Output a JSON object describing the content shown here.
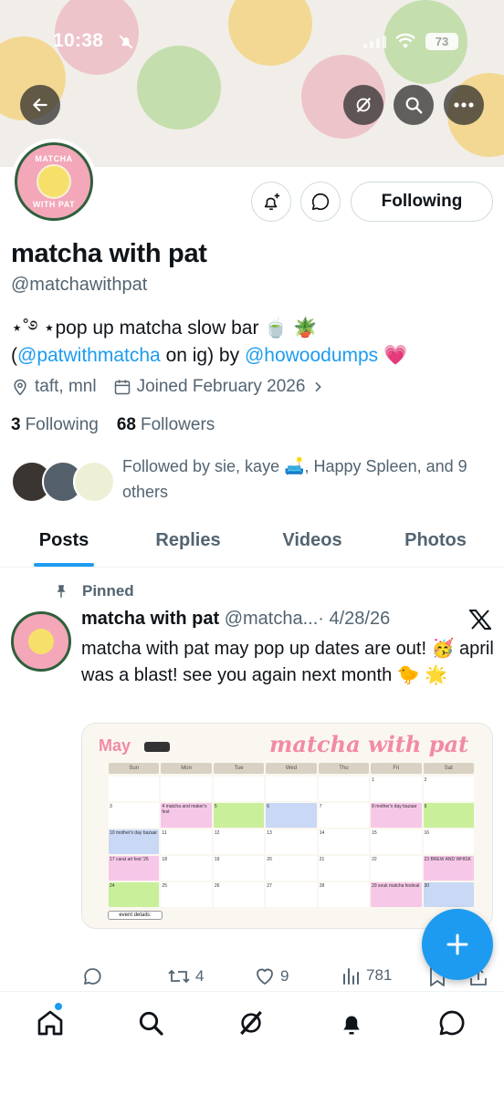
{
  "status_bar": {
    "time": "10:38",
    "battery": "73"
  },
  "profile": {
    "name": "matcha with pat",
    "handle": "@matchawithpat",
    "bio_line1": "⋆˚࿔ ⋆pop up matcha slow bar 🍵 🪴",
    "bio_open": "(",
    "bio_link1": "@patwithmatcha",
    "bio_mid": " on ig) by ",
    "bio_link2": "@howoodumps",
    "bio_end": " 💗",
    "location": "taft, mnl",
    "joined": "Joined February 2026",
    "following_count": "3",
    "following_label": "Following",
    "followers_count": "68",
    "followers_label": "Followers",
    "followed_by": "Followed by sie, kaye 🛋️, Happy Spleen, and 9 others"
  },
  "buttons": {
    "following": "Following"
  },
  "avatar": {
    "ring_top": "MATCHA",
    "ring_bottom": "WITH PAT"
  },
  "tabs": [
    {
      "label": "Posts",
      "active": true
    },
    {
      "label": "Replies",
      "active": false
    },
    {
      "label": "Videos",
      "active": false
    },
    {
      "label": "Photos",
      "active": false
    }
  ],
  "post": {
    "pinned_label": "Pinned",
    "author": "matcha with pat",
    "handle": "@matcha...",
    "date": "· 4/28/26",
    "text": "matcha with pat may pop up dates are out! 🥳 april was a blast! see you again next month 🐤 🌟",
    "media": {
      "month": "May",
      "script_title": "matcha with pat",
      "days": [
        "Sun",
        "Mon",
        "Tue",
        "Wed",
        "Thu",
        "Fri",
        "Sat"
      ],
      "weeks": [
        [
          "",
          "",
          "",
          "",
          "",
          "1",
          "2"
        ],
        [
          "3",
          "4 matcha and maker's fest",
          "5",
          "6",
          "7",
          "8 mother's day bazaar",
          "9"
        ],
        [
          "10 mother's day bazaar",
          "11",
          "12",
          "13",
          "14",
          "15",
          "16"
        ],
        [
          "17 carat art fest '26",
          "18",
          "19",
          "20",
          "21",
          "22",
          "23 BREW AND WHISK"
        ],
        [
          "24",
          "25",
          "26",
          "27",
          "28",
          "29 souk matcha festival",
          "30"
        ]
      ],
      "details_label": "event details:"
    },
    "stats": {
      "replies": "",
      "reposts": "4",
      "likes": "9",
      "views": "781"
    }
  },
  "colors": {
    "accent": "#1d9bf0",
    "text": "#0f1419",
    "secondary": "#536471",
    "brand_pink": "#f3a7b9",
    "brand_green": "#2f5f3c"
  }
}
